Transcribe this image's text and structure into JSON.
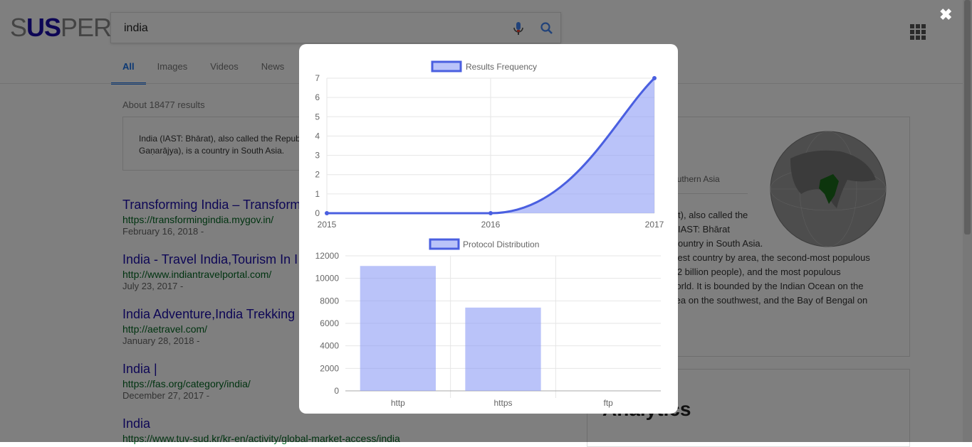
{
  "header": {
    "logo_parts": [
      "S",
      "US",
      "PER"
    ],
    "search_value": "india"
  },
  "tabs": [
    {
      "label": "All",
      "active": true
    },
    {
      "label": "Images",
      "active": false
    },
    {
      "label": "Videos",
      "active": false
    },
    {
      "label": "News",
      "active": false
    }
  ],
  "results_count": "About 18477 results",
  "snippet": {
    "line1": "India (IAST: Bhārat), also called the Repub",
    "line2": "Gaṇarājya), is a country in South Asia."
  },
  "results": [
    {
      "title": "Transforming India – Transform",
      "url": "https://transformingindia.mygov.in/",
      "date": "February 16, 2018 -"
    },
    {
      "title": "India - Travel India,Tourism In I",
      "url": "http://www.indiantravelportal.com/",
      "date": "July 23, 2017 -"
    },
    {
      "title": "India Adventure,India Trekking",
      "url": "http://aetravel.com/",
      "date": "January 28, 2018 -"
    },
    {
      "title": "India |",
      "url": "https://fas.org/category/india/",
      "date": "December 27, 2017 -"
    },
    {
      "title": "India",
      "url": "https://www.tuv-sud.kr/kr-en/activity/global-market-access/india",
      "date": ""
    }
  ],
  "knowledge": {
    "subtitle": "outhern Asia",
    "lines": [
      "t), also called the",
      "IAST: Bhārat",
      "ountry in South Asia.",
      "rgest country by area, the second-most populous",
      "1.2 billion people), and the most populous",
      "world. It is bounded by the Indian Ocean on the",
      " Sea on the southwest, and the Bay of Bengal on"
    ]
  },
  "analytics_title": "Analytics",
  "modal": {
    "close_glyph": "✖"
  },
  "colors": {
    "series_fill": "rgba(140,155,245,0.6)",
    "series_line": "#4a5fe0",
    "link": "#1a0dab",
    "url": "#006621"
  },
  "chart_data": [
    {
      "type": "area",
      "legend": "Results Frequency",
      "x": [
        "2015",
        "2016",
        "2017"
      ],
      "series": [
        {
          "name": "Results Frequency",
          "values": [
            0,
            0,
            7
          ]
        }
      ],
      "ylim": [
        0,
        7
      ],
      "yticks": [
        0,
        1,
        2,
        3,
        4,
        5,
        6,
        7
      ],
      "grid": true,
      "legend_position": "top"
    },
    {
      "type": "bar",
      "legend": "Protocol Distribution",
      "categories": [
        "http",
        "https",
        "ftp"
      ],
      "series": [
        {
          "name": "Protocol Distribution",
          "values": [
            11100,
            7400,
            0
          ]
        }
      ],
      "ylim": [
        0,
        12000
      ],
      "yticks": [
        0,
        2000,
        4000,
        6000,
        8000,
        10000,
        12000
      ],
      "grid": true,
      "legend_position": "top"
    }
  ]
}
